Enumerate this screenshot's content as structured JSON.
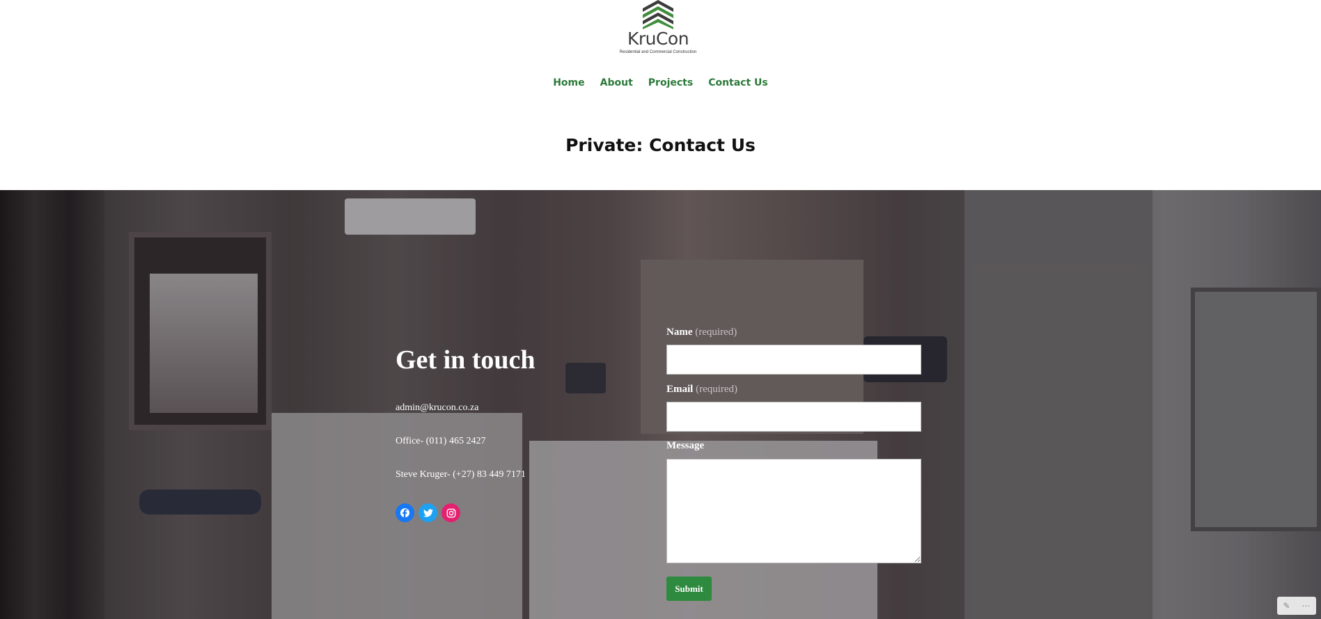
{
  "logo": {
    "name": "KruCon",
    "tagline": "Residential and Commercial Construction",
    "color_green": "#3f8d3d",
    "color_dark": "#3c3c3c"
  },
  "nav": {
    "items": [
      "Home",
      "About",
      "Projects",
      "Contact Us"
    ],
    "color": "#2c7a3a"
  },
  "page": {
    "title": "Private: Contact Us"
  },
  "contact": {
    "heading": "Get in touch",
    "email": "admin@krucon.co.za",
    "office": "Office- (011) 465 2427",
    "mobile": "Steve Kruger- (+27) 83 449 7171",
    "social": [
      {
        "icon": "facebook-icon",
        "color": "#1877f2"
      },
      {
        "icon": "twitter-icon",
        "color": "#1da1f2"
      },
      {
        "icon": "instagram-icon",
        "color": "#e4206f"
      }
    ]
  },
  "form": {
    "name_label": "Name",
    "email_label": "Email",
    "required": "(required)",
    "message_label": "Message",
    "submit_label": "Submit",
    "button_color": "#2e8a3e"
  }
}
